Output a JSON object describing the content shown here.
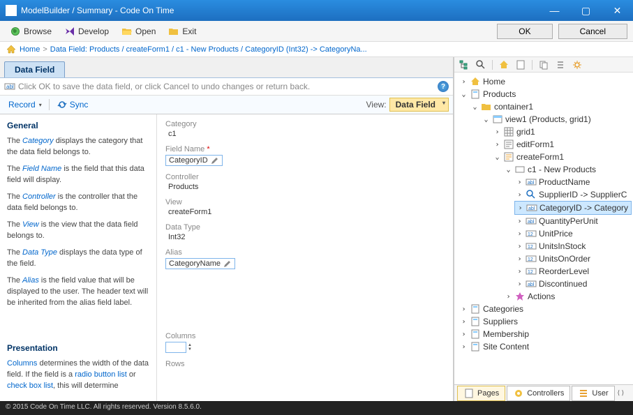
{
  "window": {
    "title": "ModelBuilder / Summary - Code On Time"
  },
  "toolbar": {
    "browse": "Browse",
    "develop": "Develop",
    "open": "Open",
    "exit": "Exit",
    "ok": "OK",
    "cancel": "Cancel"
  },
  "breadcrumb": {
    "home": "Home",
    "path": "Data Field: Products / createForm1 / c1 - New Products / CategoryID (Int32) -> CategoryNa..."
  },
  "tab": "Data Field",
  "hint": "Click OK to save the data field, or click Cancel to undo changes or return back.",
  "menubar": {
    "record": "Record",
    "sync": "Sync",
    "view_label": "View:",
    "view_value": "Data Field"
  },
  "help_general": {
    "title": "General",
    "p1_a": "The ",
    "p1_t": "Category",
    "p1_b": " displays the category that the data field belongs to.",
    "p2_a": "The ",
    "p2_t": "Field Name",
    "p2_b": " is the field that this data field will display.",
    "p3_a": "The ",
    "p3_t": "Controller",
    "p3_b": " is the controller that the data field belongs to.",
    "p4_a": "The ",
    "p4_t": "View",
    "p4_b": " is the view that the data field belongs to.",
    "p5_a": "The ",
    "p5_t": "Data Type",
    "p5_b": " displays the data type of the field.",
    "p6_a": "The ",
    "p6_t": "Alias",
    "p6_b": " is the field value that will be displayed to the user. The header text will be inherited from the alias field label."
  },
  "help_pres": {
    "title": "Presentation",
    "p1_a": "",
    "p1_t": "Columns",
    "p1_b": " determines the width of the data field. If the field is a ",
    "p1_t2": "radio button list",
    "p1_c": " or ",
    "p1_t3": "check box list",
    "p1_d": ", this will determine"
  },
  "form": {
    "category_label": "Category",
    "category_value": "c1",
    "fieldname_label": "Field Name",
    "fieldname_value": "CategoryID",
    "controller_label": "Controller",
    "controller_value": "Products",
    "view_label": "View",
    "view_value": "createForm1",
    "datatype_label": "Data Type",
    "datatype_value": "Int32",
    "alias_label": "Alias",
    "alias_value": "CategoryName",
    "columns_label": "Columns",
    "columns_value": "",
    "rows_label": "Rows"
  },
  "tree": {
    "home": "Home",
    "products": "Products",
    "container1": "container1",
    "view1": "view1 (Products, grid1)",
    "grid1": "grid1",
    "editForm1": "editForm1",
    "createForm1": "createForm1",
    "c1": "c1 - New Products",
    "productName": "ProductName",
    "supplierID": "SupplierID -> SupplierC",
    "categoryID": "CategoryID -> Category",
    "qpu": "QuantityPerUnit",
    "unitPrice": "UnitPrice",
    "unitsInStock": "UnitsInStock",
    "unitsOnOrder": "UnitsOnOrder",
    "reorderLevel": "ReorderLevel",
    "discontinued": "Discontinued",
    "actions": "Actions",
    "categories": "Categories",
    "suppliers": "Suppliers",
    "membership": "Membership",
    "siteContent": "Site Content"
  },
  "bottom_tabs": {
    "pages": "Pages",
    "controllers": "Controllers",
    "user": "User"
  },
  "footer": "© 2015 Code On Time LLC. All rights reserved. Version 8.5.6.0."
}
